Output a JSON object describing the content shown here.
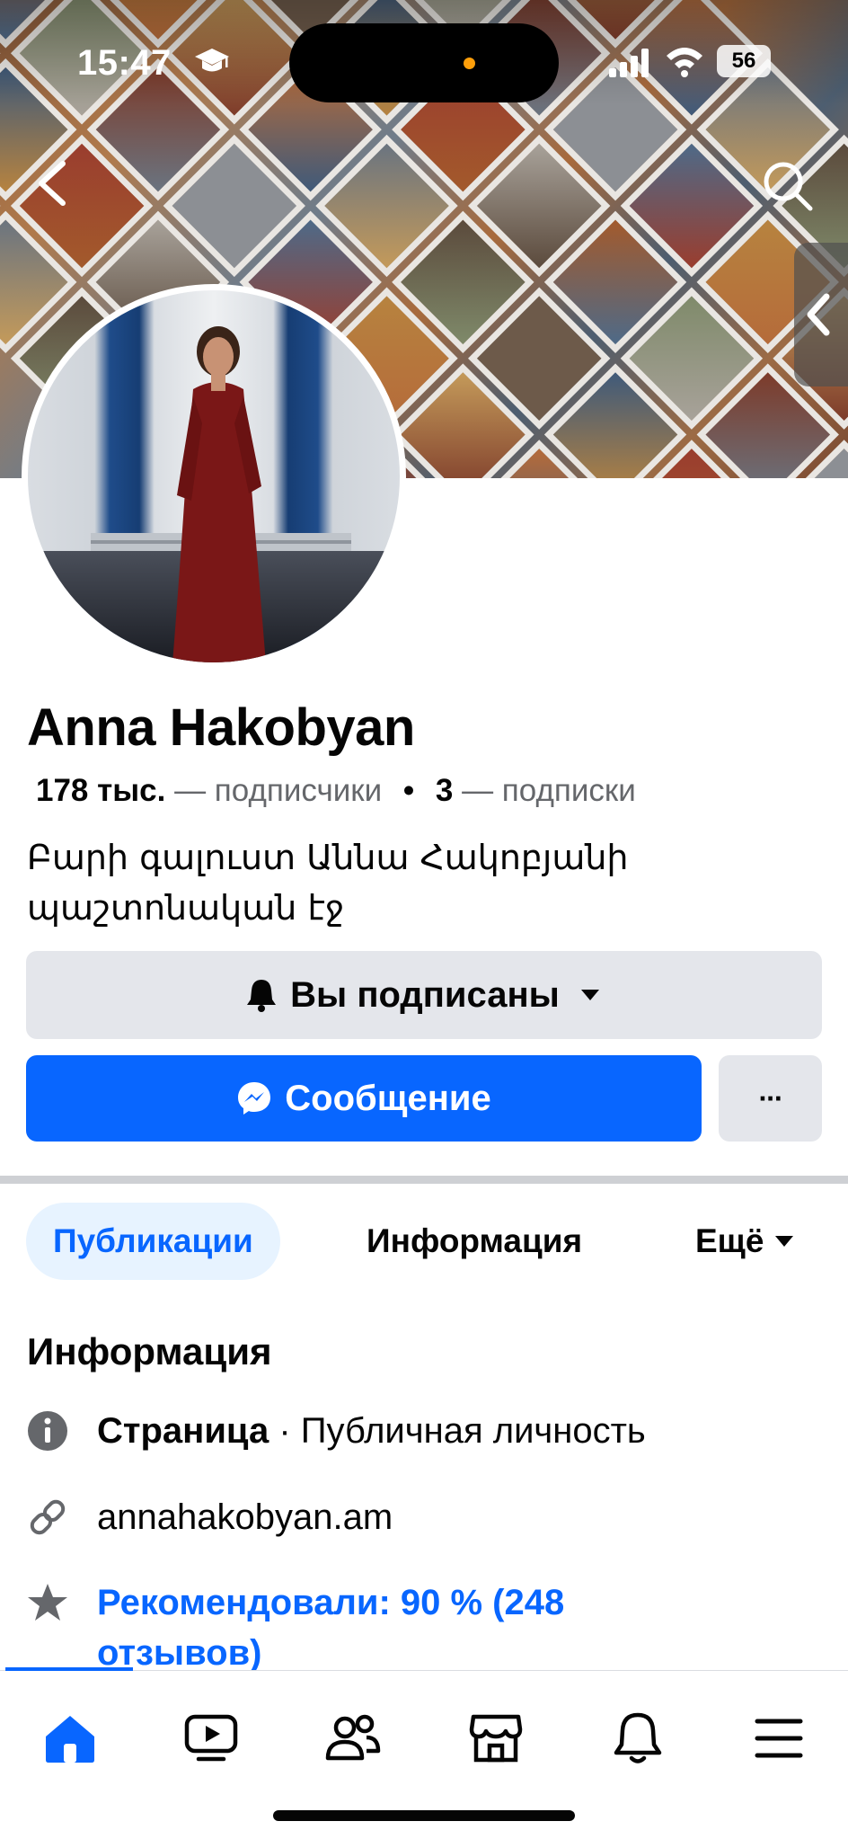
{
  "status_bar": {
    "time": "15:47",
    "battery": "56"
  },
  "profile": {
    "name": "Anna Hakobyan",
    "followers_count": "178 тыс.",
    "followers_label": "— подписчики",
    "separator": "•",
    "following_count": "3",
    "following_label": "— подписки",
    "bio": "Բարի գալուստ Աննա Հակոբյանի պաշտոնական էջ"
  },
  "actions": {
    "follow_label": "Вы подписаны",
    "message_label": "Сообщение",
    "more_label": "···"
  },
  "tabs": [
    {
      "label": "Публикации",
      "active": true
    },
    {
      "label": "Информация",
      "active": false
    },
    {
      "label": "Ещё",
      "active": false
    }
  ],
  "info": {
    "title": "Информация",
    "page_type_bold": "Страница",
    "page_type_rest": " · Публичная личность",
    "website": "annahakobyan.am",
    "rating": "Рекомендовали: 90 % (248 отзывов)"
  },
  "bottom_nav": [
    "home-icon",
    "video-icon",
    "friends-icon",
    "marketplace-icon",
    "notifications-icon",
    "menu-icon"
  ],
  "colors": {
    "accent": "#0866ff",
    "button_gray": "#e4e6eb",
    "tab_active_bg": "#e7f3ff"
  }
}
